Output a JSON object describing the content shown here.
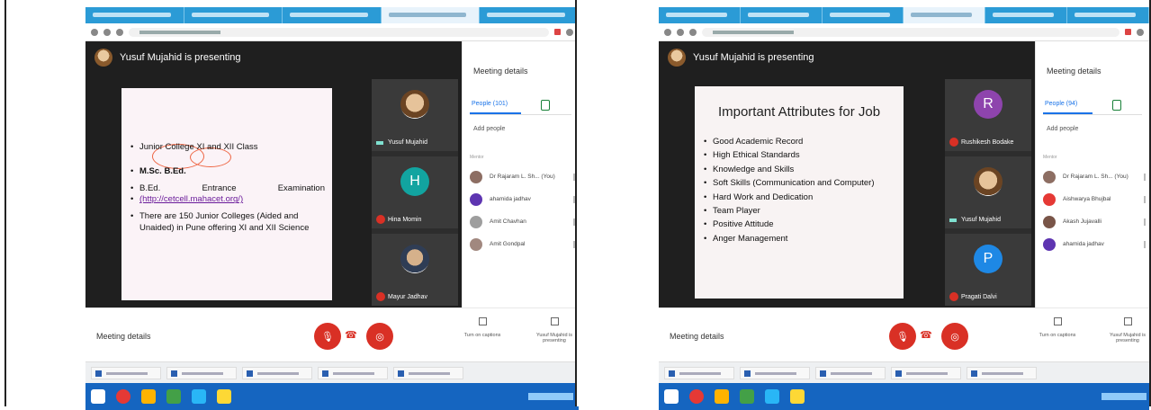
{
  "left": {
    "presenter": "Yusuf Mujahid is presenting",
    "slide_items": [
      "Junior College XI and XII Class",
      "M.Sc. B.Ed.",
      "B.Ed.",
      "Entrance",
      "Examination",
      "(http://cetcell.mahacet.org/)",
      "There are 150 Junior Colleges (Aided and Unaided) in Pune offering XI and XII Science"
    ],
    "tiles": [
      {
        "name": "Yusuf Mujahid",
        "initial": ""
      },
      {
        "name": "Hina Momin",
        "initial": "H",
        "color": "#12a4a0"
      },
      {
        "name": "Mayur Jadhav",
        "initial": ""
      }
    ],
    "sidebar": {
      "title": "Meeting details",
      "people_tab": "People (101)",
      "add_people": "Add people",
      "section": "Mentor",
      "people": [
        {
          "name": "Dr Rajaram L. Sh... (You)",
          "color": "#8d6e63"
        },
        {
          "name": "ahamida jadhav",
          "color": "#5e35b1"
        },
        {
          "name": "Amit Chavhan",
          "color": "#9e9e9e"
        },
        {
          "name": "Amit Gondpal",
          "color": "#a1887f"
        }
      ]
    },
    "bottom": {
      "meeting_details": "Meeting details",
      "captions": "Turn on captions",
      "presenting": "Yusuf Mujahid is presenting"
    }
  },
  "right": {
    "presenter": "Yusuf Mujahid is presenting",
    "slide_title": "Important Attributes for Job",
    "slide_items": [
      "Good Academic Record",
      "High Ethical Standards",
      "Knowledge and Skills",
      "Soft Skills (Communication and Computer)",
      "Hard Work and Dedication",
      "Team Player",
      "Positive Attitude",
      "Anger Management"
    ],
    "tiles": [
      {
        "name": "Rushikesh Bodake",
        "initial": "R",
        "color": "#8e44ad"
      },
      {
        "name": "Yusuf Mujahid",
        "initial": ""
      },
      {
        "name": "Pragati Dalvi",
        "initial": "P",
        "color": "#1e88e5"
      }
    ],
    "sidebar": {
      "title": "Meeting details",
      "people_tab": "People (94)",
      "add_people": "Add people",
      "section": "Mentor",
      "people": [
        {
          "name": "Dr Rajaram L. Sh... (You)",
          "color": "#8d6e63"
        },
        {
          "name": "Aishwarya Bhujbal",
          "color": "#e53935"
        },
        {
          "name": "Akash Jujavalli",
          "color": "#795548"
        },
        {
          "name": "ahamida jadhav",
          "color": "#5e35b1"
        }
      ]
    },
    "bottom": {
      "meeting_details": "Meeting details",
      "captions": "Turn on captions",
      "presenting": "Yusuf Mujahid is presenting"
    }
  }
}
